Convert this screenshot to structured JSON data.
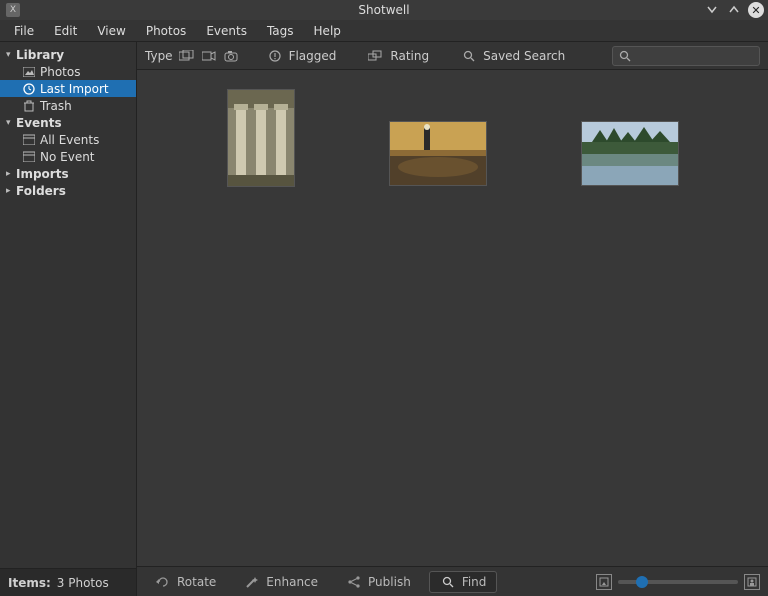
{
  "window": {
    "title": "Shotwell"
  },
  "menubar": [
    "File",
    "Edit",
    "View",
    "Photos",
    "Events",
    "Tags",
    "Help"
  ],
  "sidebar": {
    "groups": [
      {
        "label": "Library",
        "expanded": true,
        "children": [
          {
            "label": "Photos",
            "icon": "photos"
          },
          {
            "label": "Last Import",
            "icon": "clock",
            "selected": true
          },
          {
            "label": "Trash",
            "icon": "trash"
          }
        ]
      },
      {
        "label": "Events",
        "expanded": true,
        "children": [
          {
            "label": "All Events",
            "icon": "calendar"
          },
          {
            "label": "No Event",
            "icon": "calendar"
          }
        ]
      },
      {
        "label": "Imports",
        "expanded": false,
        "children": []
      },
      {
        "label": "Folders",
        "expanded": false,
        "children": []
      }
    ]
  },
  "status": {
    "label": "Items:",
    "value": "3 Photos"
  },
  "toolbar": {
    "type_label": "Type",
    "flagged_label": "Flagged",
    "rating_label": "Rating",
    "savedsearch_label": "Saved Search"
  },
  "thumbnails": [
    {
      "name": "photo-1"
    },
    {
      "name": "photo-2"
    },
    {
      "name": "photo-3"
    }
  ],
  "bottombar": {
    "rotate": "Rotate",
    "enhance": "Enhance",
    "publish": "Publish",
    "find": "Find"
  }
}
